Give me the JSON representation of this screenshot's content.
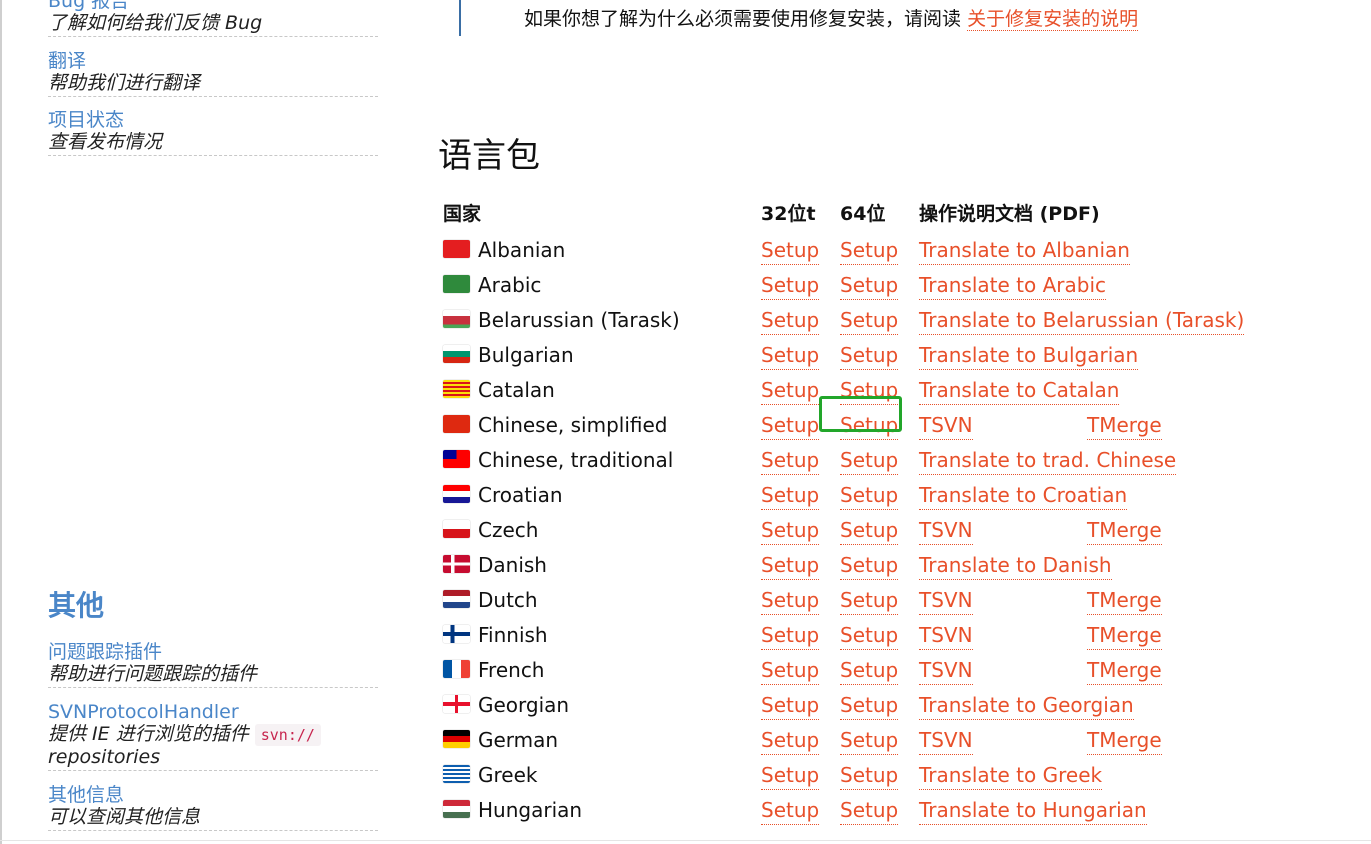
{
  "sidebar": {
    "entries": [
      {
        "link": "Bug 报告",
        "desc": "了解如何给我们反馈 Bug"
      },
      {
        "link": "翻译",
        "desc": "帮助我们进行翻译"
      },
      {
        "link": "项目状态",
        "desc": "查看发布情况"
      }
    ],
    "other_heading": "其他",
    "other_entries": [
      {
        "link": "问题跟踪插件",
        "desc": "帮助进行问题跟踪的插件"
      },
      {
        "link": "SVNProtocolHandler",
        "desc": "提供 IE 进行浏览的插件",
        "code": "svn://",
        "desc2": "repositories"
      },
      {
        "link": "其他信息",
        "desc": "可以查阅其他信息"
      }
    ]
  },
  "notice": {
    "text": "如果你想了解为什么必须需要使用修复安装，请阅读",
    "link": "关于修复安装的说明"
  },
  "section_title": "语言包",
  "table": {
    "headers": {
      "country": "国家",
      "bit32": "32位t",
      "bit64": "64位",
      "doc": "操作说明文档 (PDF)"
    },
    "rows": [
      {
        "name": "Albanian",
        "s32": "Setup",
        "s64": "Setup",
        "doc": "Translate to Albanian"
      },
      {
        "name": "Arabic",
        "s32": "Setup",
        "s64": "Setup",
        "doc": "Translate to Arabic"
      },
      {
        "name": "Belarussian (Tarask)",
        "s32": "Setup",
        "s64": "Setup",
        "doc": "Translate to Belarussian (Tarask)"
      },
      {
        "name": "Bulgarian",
        "s32": "Setup",
        "s64": "Setup",
        "doc": "Translate to Bulgarian"
      },
      {
        "name": "Catalan",
        "s32": "Setup",
        "s64": "Setup",
        "doc": "Translate to Catalan"
      },
      {
        "name": "Chinese, simplified",
        "s32": "Setup",
        "s64": "Setup",
        "doc": "TSVN",
        "merge": "TMerge"
      },
      {
        "name": "Chinese, traditional",
        "s32": "Setup",
        "s64": "Setup",
        "doc": "Translate to trad. Chinese"
      },
      {
        "name": "Croatian",
        "s32": "Setup",
        "s64": "Setup",
        "doc": "Translate to Croatian"
      },
      {
        "name": "Czech",
        "s32": "Setup",
        "s64": "Setup",
        "doc": "TSVN",
        "merge": "TMerge"
      },
      {
        "name": "Danish",
        "s32": "Setup",
        "s64": "Setup",
        "doc": "Translate to Danish"
      },
      {
        "name": "Dutch",
        "s32": "Setup",
        "s64": "Setup",
        "doc": "TSVN",
        "merge": "TMerge"
      },
      {
        "name": "Finnish",
        "s32": "Setup",
        "s64": "Setup",
        "doc": "TSVN",
        "merge": "TMerge"
      },
      {
        "name": "French",
        "s32": "Setup",
        "s64": "Setup",
        "doc": "TSVN",
        "merge": "TMerge"
      },
      {
        "name": "Georgian",
        "s32": "Setup",
        "s64": "Setup",
        "doc": "Translate to Georgian"
      },
      {
        "name": "German",
        "s32": "Setup",
        "s64": "Setup",
        "doc": "TSVN",
        "merge": "TMerge"
      },
      {
        "name": "Greek",
        "s32": "Setup",
        "s64": "Setup",
        "doc": "Translate to Greek"
      },
      {
        "name": "Hungarian",
        "s32": "Setup",
        "s64": "Setup",
        "doc": "Translate to Hungarian"
      }
    ]
  },
  "colors": {
    "link": "#e8502a",
    "sidebar_link": "#4a86c8",
    "highlight": "#22a62a"
  }
}
